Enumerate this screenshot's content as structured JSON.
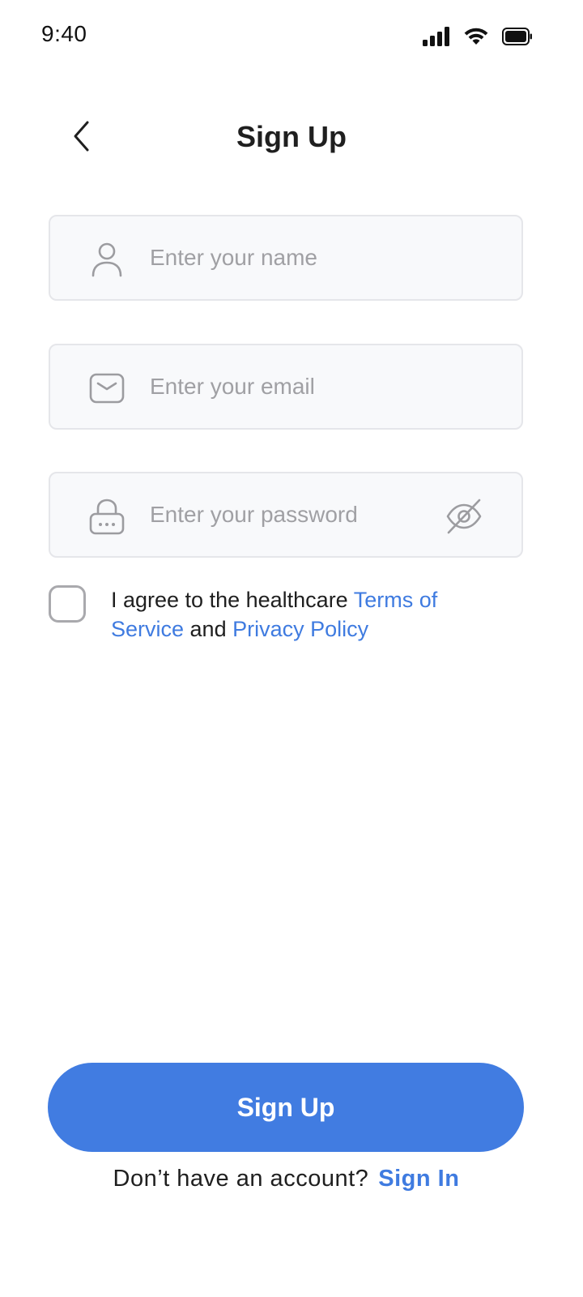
{
  "status_bar": {
    "time": "9:40",
    "icons": [
      "cellular-signal-icon",
      "wifi-icon",
      "battery-icon"
    ]
  },
  "header": {
    "title": "Sign Up",
    "back_icon": "chevron-left-icon"
  },
  "form": {
    "name": {
      "placeholder": "Enter your name",
      "value": "",
      "icon": "user-icon"
    },
    "email": {
      "placeholder": "Enter your email",
      "value": "",
      "icon": "envelope-icon"
    },
    "password": {
      "placeholder": "Enter your password",
      "value": "",
      "icon": "lock-icon",
      "toggle_icon": "eye-off-icon"
    }
  },
  "agreement": {
    "checked": false,
    "prefix": "I agree to the healthcare ",
    "terms_link": "Terms of Service",
    "middle": " and ",
    "privacy_link": "Privacy Policy"
  },
  "actions": {
    "primary_label": "Sign Up",
    "account_prompt": "Don’t have an account?",
    "signin_link": "Sign In"
  },
  "colors": {
    "accent": "#417ce1",
    "link": "#3f7be0",
    "field_bg": "#f8f9fb",
    "field_border": "#e5e6ea",
    "placeholder": "#a0a0a4",
    "text": "#1f1f1f"
  }
}
